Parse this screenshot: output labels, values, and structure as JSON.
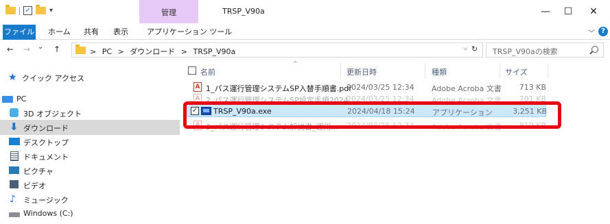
{
  "window": {
    "title": "TRSP_V90a",
    "manage_tab": "管理",
    "minimize": "—",
    "maximize": "☐",
    "close": "✕"
  },
  "quick_access_toolbar": {
    "divider": "|",
    "dropdown": "▾",
    "check": "✓"
  },
  "ribbon": {
    "tabs": [
      "ファイル",
      "ホーム",
      "共有",
      "表示",
      "アプリケーション ツール"
    ],
    "expand": "﹀",
    "help": "?"
  },
  "navigation": {
    "back": "←",
    "forward": "→",
    "recent": "⌄",
    "up": "↑",
    "breadcrumb": [
      ">",
      "PC",
      ">",
      "ダウンロード",
      ">",
      "TRSP_V90a"
    ],
    "address_dropdown": "⌵",
    "refresh": "↻",
    "search_placeholder": "TRSP_V90aの検索"
  },
  "sidebar": {
    "items": [
      {
        "label": "クイック アクセス",
        "icon": "star-icon"
      },
      {
        "label": "PC",
        "icon": "pc-icon"
      },
      {
        "label": "3D オブジェクト",
        "icon": "3d-objects-icon"
      },
      {
        "label": "ダウンロード",
        "icon": "download-icon",
        "selected": true
      },
      {
        "label": "デスクトップ",
        "icon": "desktop-icon"
      },
      {
        "label": "ドキュメント",
        "icon": "document-icon"
      },
      {
        "label": "ピクチャ",
        "icon": "pictures-icon"
      },
      {
        "label": "ビデオ",
        "icon": "video-icon"
      },
      {
        "label": "ミュージック",
        "icon": "music-icon"
      },
      {
        "label": "Windows (C:)",
        "icon": "drive-icon"
      }
    ]
  },
  "file_list": {
    "sort_indicator": "^",
    "columns": [
      "名前",
      "更新日時",
      "種類",
      "サイズ"
    ],
    "rows": [
      {
        "name": "1_パス運行管理システムSP入替手順書.pdf",
        "modified": "2024/03/25 12:34",
        "type": "Adobe Acroba 文書",
        "size": "713 KB",
        "icon": "pdf-icon"
      },
      {
        "name": "2_パス運行管理システムSP設定手順2024...",
        "modified": "2024/03/25 12:34",
        "type": "Adobe Acroba 文書",
        "size": "701 KB",
        "icon": "pdf-icon"
      },
      {
        "name": "TRSP_V90a.exe",
        "modified": "2024/04/18 15:24",
        "type": "アプリケーション",
        "size": "3,251 KB",
        "icon": "exe-icon",
        "selected": true
      },
      {
        "name": "3_パス運行管理システム解説書_運用...",
        "modified": "2024/03/25 12:34",
        "type": "Adobe Acroba 文書",
        "size": "819 KB",
        "icon": "pdf-icon"
      }
    ]
  },
  "colors": {
    "accent": "#1979ca",
    "selection": "#cce8ff",
    "highlight_box": "#e60012",
    "manage_tab": "#e7c9f5"
  }
}
